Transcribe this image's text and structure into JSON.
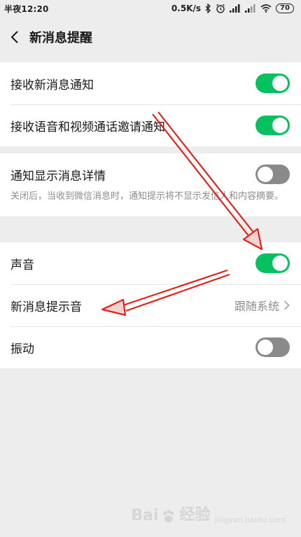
{
  "status_bar": {
    "time": "半夜12:20",
    "speed": "0.5K/s",
    "battery": "70"
  },
  "header": {
    "title": "新消息提醒"
  },
  "group1": {
    "items": [
      {
        "label": "接收新消息通知",
        "toggle_on": true
      },
      {
        "label": "接收语音和视频通话邀请通知",
        "toggle_on": true
      }
    ]
  },
  "group2": {
    "label": "通知显示消息详情",
    "toggle_on": false,
    "description": "关闭后，当收到微信消息时，通知提示将不显示发信人和内容摘要。"
  },
  "group3": {
    "sound_label": "声音",
    "sound_on": true,
    "tone_label": "新消息提示音",
    "tone_value": "跟随系统",
    "vibrate_label": "振动",
    "vibrate_on": false
  },
  "watermark": {
    "brand": "Bai",
    "brand_cn": "经验",
    "sub": "jingyan.baidu.com"
  },
  "colors": {
    "accent_green": "#07c160",
    "annotation_red": "#e0241b"
  }
}
